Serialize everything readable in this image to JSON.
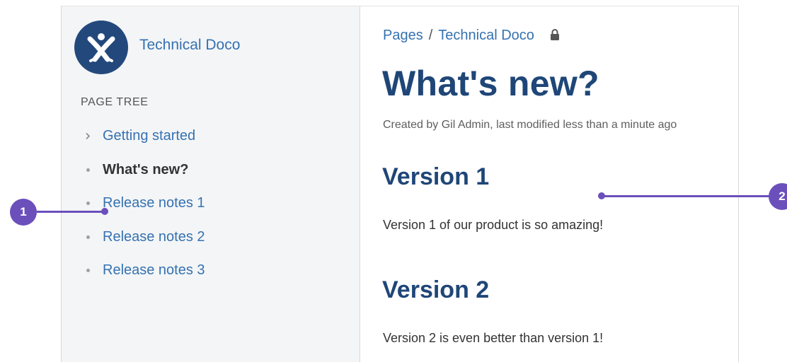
{
  "space": {
    "name": "Technical Doco",
    "logo_icon": "atlassian-x-logo-icon",
    "logo_color": "#23497c"
  },
  "page_tree": {
    "heading": "PAGE TREE",
    "items": [
      {
        "label": "Getting started",
        "marker": "chevron-right-icon",
        "current": false
      },
      {
        "label": "What's new?",
        "marker": "bullet",
        "current": true
      },
      {
        "label": "Release notes 1",
        "marker": "bullet",
        "current": false
      },
      {
        "label": "Release notes 2",
        "marker": "bullet",
        "current": false
      },
      {
        "label": "Release notes 3",
        "marker": "bullet",
        "current": false
      }
    ]
  },
  "breadcrumb": {
    "items": [
      "Pages",
      "Technical Doco"
    ],
    "separator": "/",
    "restriction_icon": "lock-icon"
  },
  "page": {
    "title": "What's new?",
    "meta": "Created by Gil Admin, last modified less than a minute ago",
    "sections": [
      {
        "heading": "Version 1",
        "text": "Version 1 of our product is so amazing!"
      },
      {
        "heading": "Version 2",
        "text": "Version 2 is even better than version 1!"
      }
    ]
  },
  "callouts": [
    {
      "label": "1",
      "target": "page tree"
    },
    {
      "label": "2",
      "target": "page content"
    }
  ],
  "colors": {
    "link": "#3572b0",
    "heading": "#1f4677",
    "sidebar_bg": "#f4f5f7",
    "callout": "#6b4fbb"
  }
}
